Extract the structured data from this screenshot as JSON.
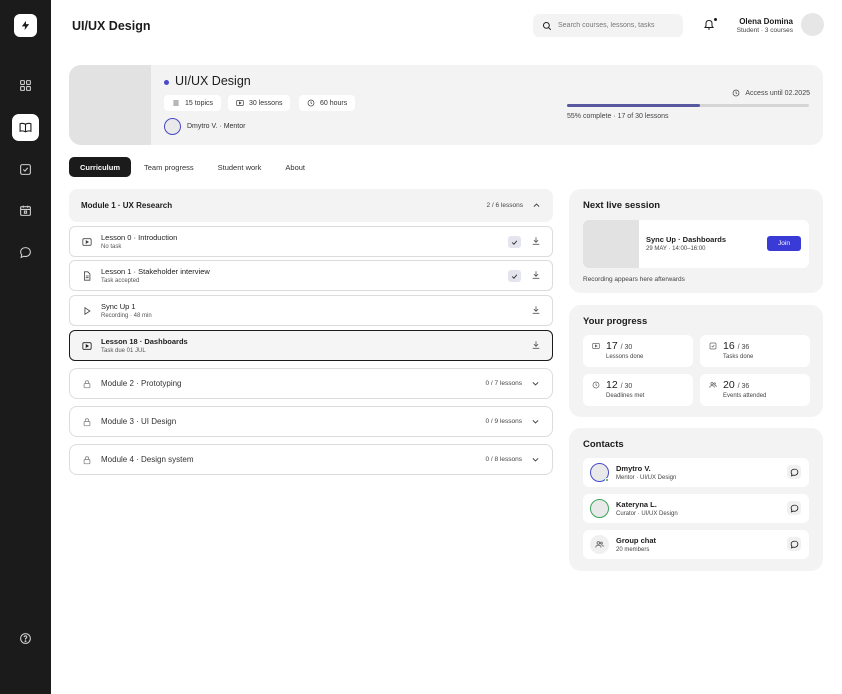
{
  "header": {
    "title": "UI/UX Design",
    "search_placeholder": "Search courses, lessons, tasks",
    "user_name": "Olena Domina",
    "user_sub": "Student · 3 courses"
  },
  "sidebar": {
    "items": [
      {
        "icon": "grid-icon",
        "active": false
      },
      {
        "icon": "book-icon",
        "active": true
      },
      {
        "icon": "checkbox-icon",
        "active": false
      },
      {
        "icon": "calendar-icon",
        "active": false
      },
      {
        "icon": "chat-icon",
        "active": false
      },
      {
        "icon": "help-icon",
        "active": false
      }
    ]
  },
  "course": {
    "title": "UI/UX Design",
    "topics": "15 topics",
    "lessons": "30 lessons",
    "hours": "60 hours",
    "mentor": "Dmytro V. · Mentor",
    "access": "Access until 02.2025",
    "progress_fraction": 0.55,
    "progress_text": "55% complete · 17 of 30 lessons"
  },
  "tabs": [
    {
      "label": "Curriculum",
      "active": true
    },
    {
      "label": "Team progress",
      "active": false
    },
    {
      "label": "Student work",
      "active": false
    },
    {
      "label": "About",
      "active": false
    }
  ],
  "module_open": {
    "title": "Module 1 · UX Research",
    "count": "2 / 6 lessons",
    "lessons": [
      {
        "title": "Lesson 0 · Introduction",
        "sub": "No task",
        "icon": "video-icon",
        "done": true
      },
      {
        "title": "Lesson 1 · Stakeholder interview",
        "sub": "Task accepted",
        "icon": "document-icon",
        "done": true
      },
      {
        "title": "Sync Up 1",
        "sub": "Recording · 48 min",
        "icon": "play-icon",
        "done": false
      },
      {
        "title": "Lesson 18 · Dashboards",
        "sub": "Task due 01 JUL",
        "icon": "video-icon",
        "done": false
      }
    ]
  },
  "modules_closed": [
    {
      "title": "Module 2 · Prototyping",
      "count": "0 / 7 lessons"
    },
    {
      "title": "Module 3 · UI Design",
      "count": "0 / 9 lessons"
    },
    {
      "title": "Module 4 · Design system",
      "count": "0 / 8 lessons"
    }
  ],
  "live_session": {
    "heading": "Next live session",
    "title": "Sync Up · Dashboards",
    "time": "29 MAY · 14:00–16:00",
    "join_label": "Join",
    "note": "Recording appears here afterwards"
  },
  "progress": {
    "heading": "Your progress",
    "stats": [
      {
        "value": "17",
        "total": "/ 30",
        "label": "Lessons done",
        "icon": "video-icon"
      },
      {
        "value": "16",
        "total": "/ 36",
        "label": "Tasks done",
        "icon": "checkbox-icon"
      },
      {
        "value": "12",
        "total": "/ 30",
        "label": "Deadlines met",
        "icon": "clock-icon"
      },
      {
        "value": "20",
        "total": "/ 36",
        "label": "Events attended",
        "icon": "people-icon"
      }
    ]
  },
  "contacts": {
    "heading": "Contacts",
    "items": [
      {
        "name": "Dmytro V.",
        "role": "Mentor · UI/UX Design"
      },
      {
        "name": "Kateryna L.",
        "role": "Curator · UI/UX Design"
      },
      {
        "name": "Group chat",
        "role": "20 members"
      }
    ]
  }
}
